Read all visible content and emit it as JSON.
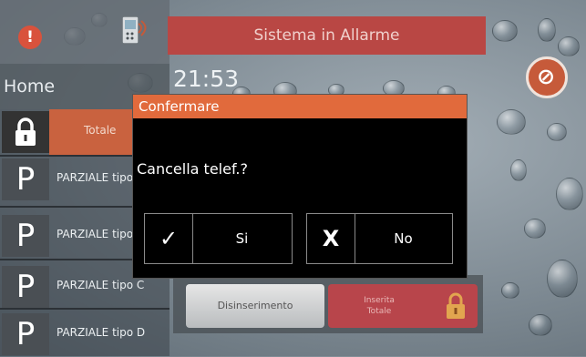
{
  "status": {
    "alarm_icon": "alert-icon",
    "device_icon": "phone-device-icon"
  },
  "banner": {
    "text": "Sistema in Allarme",
    "color": "#b94744"
  },
  "clock": "21:53",
  "home": {
    "label": "Home"
  },
  "modes": {
    "total": {
      "icon": "lock-icon",
      "label": "Totale"
    },
    "items": [
      {
        "icon": "P",
        "label": "PARZIALE tipo A"
      },
      {
        "icon": "P",
        "label": "PARZIALE tipo B"
      },
      {
        "icon": "P",
        "label": "PARZIALE tipo C"
      },
      {
        "icon": "P",
        "label": "PARZIALE tipo D"
      }
    ]
  },
  "bottom": {
    "disarm_label": "Disinserimento",
    "armed_line1": "Inserita",
    "armed_line2": "Totale"
  },
  "dialog": {
    "title": "Confermare",
    "message": "Cancella telef.?",
    "yes_symbol": "✓",
    "yes_label": "Si",
    "no_symbol": "X",
    "no_label": "No"
  },
  "colors": {
    "accent": "#e16a3c",
    "alarm": "#b94744"
  }
}
